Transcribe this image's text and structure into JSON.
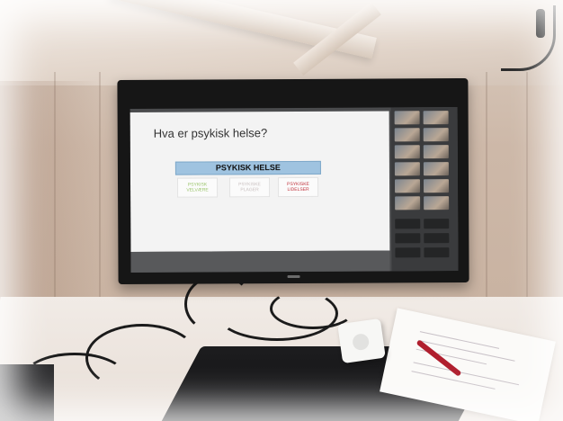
{
  "slide": {
    "title": "Hva er psykisk helse?",
    "header": "PSYKISK HELSE",
    "cards": [
      {
        "lines": [
          "PSYKISK",
          "VELVÆRE"
        ],
        "color": "#9ac46a"
      },
      {
        "lines": [
          "PSYKISKE",
          "PLAGER"
        ],
        "color": "#c9c0c0"
      },
      {
        "lines": [
          "PSYKISKE",
          "LIDELSER"
        ],
        "color": "#c0303a"
      }
    ]
  },
  "meeting": {
    "participant_tiles": 12,
    "control_buttons": 6
  }
}
